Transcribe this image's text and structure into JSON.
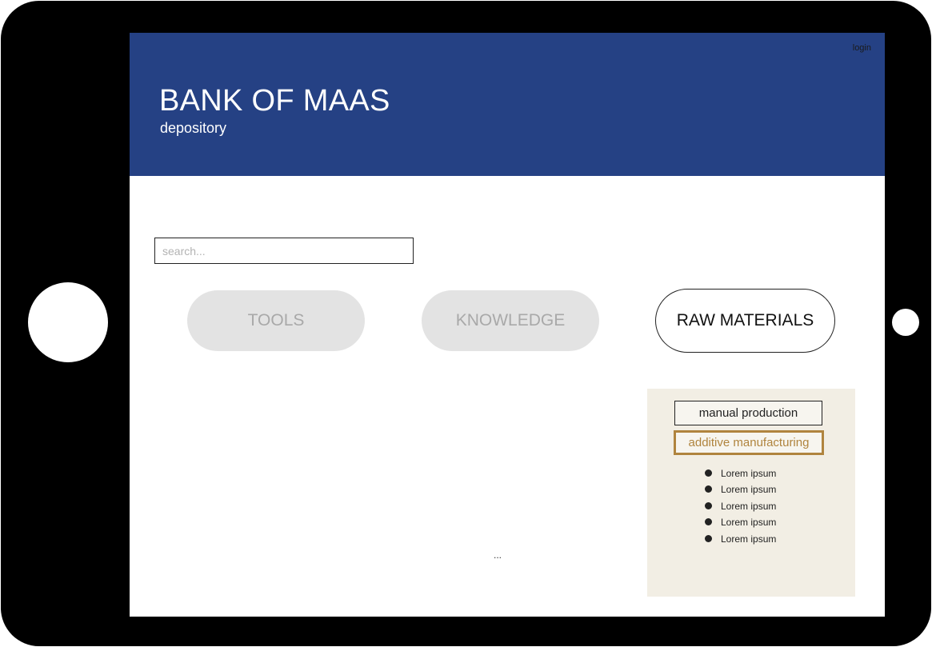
{
  "header": {
    "login_label": "login",
    "title": "BANK OF MAAS",
    "subtitle": "depository",
    "background_color": "#254184"
  },
  "search": {
    "placeholder": "search...",
    "value": ""
  },
  "categories": [
    {
      "label": "TOOLS",
      "state": "inactive"
    },
    {
      "label": "KNOWLEDGE",
      "state": "inactive"
    },
    {
      "label": "RAW MATERIALS",
      "state": "selected"
    }
  ],
  "panel": {
    "background_color": "#f2eee4",
    "options": [
      {
        "label": "manual production",
        "state": "default"
      },
      {
        "label": "additive manufacturing",
        "state": "highlighted",
        "accent_color": "#b0843e"
      }
    ],
    "items": [
      "Lorem ipsum",
      "Lorem ipsum",
      "Lorem ipsum",
      "Lorem ipsum",
      "Lorem ipsum"
    ]
  },
  "main": {
    "ellipsis": "..."
  }
}
